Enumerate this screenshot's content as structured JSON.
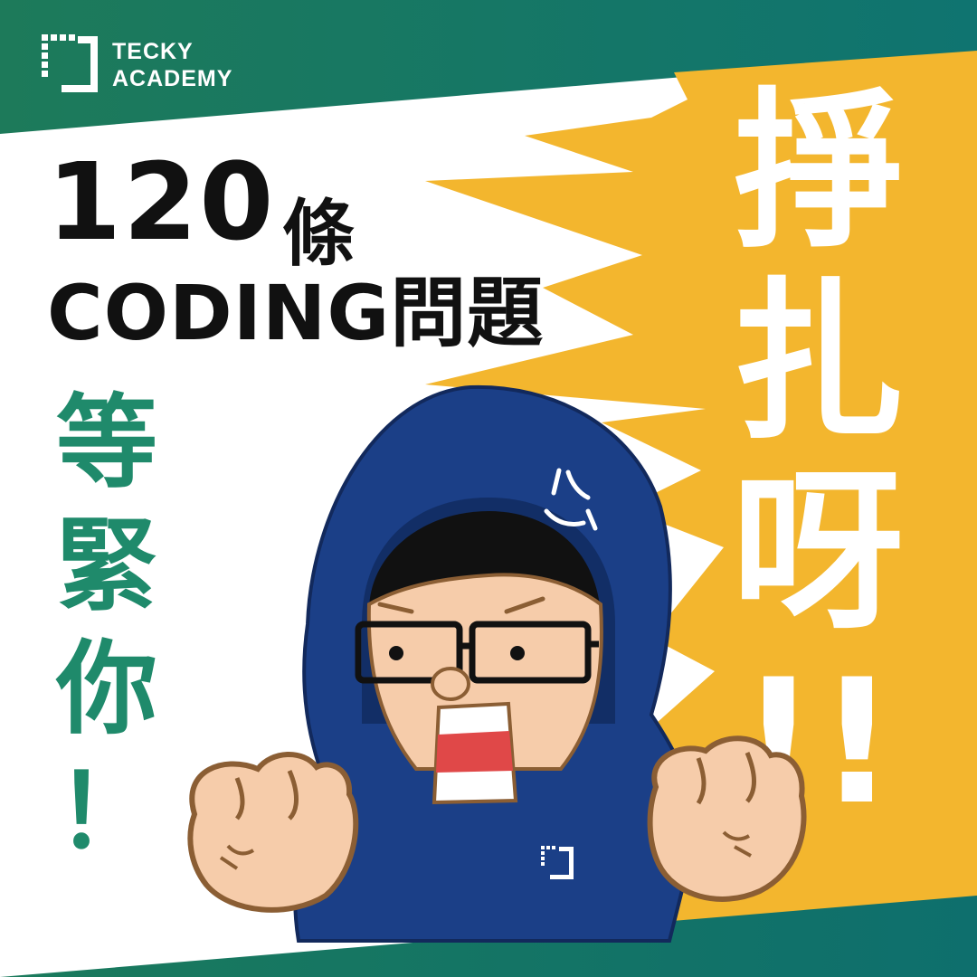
{
  "brand": {
    "line1": "TECKY",
    "line2": "ACADEMY"
  },
  "headline": {
    "number": "120",
    "measure": "條",
    "subject": "CODING問題"
  },
  "tagline": {
    "chars": [
      "等",
      "緊",
      "你",
      "！"
    ]
  },
  "shout": {
    "chars": [
      "掙",
      "扎",
      "呀",
      "!!"
    ]
  },
  "colors": {
    "teal": "#1f7f6e",
    "green_band": "#1d7a5a",
    "yellow": "#f3b62e",
    "hood_navy": "#1b3f87",
    "skin": "#f6ccaa",
    "outline": "#8b5e34",
    "mouth_red": "#e04848",
    "tagline_green": "#1f8a6b"
  }
}
